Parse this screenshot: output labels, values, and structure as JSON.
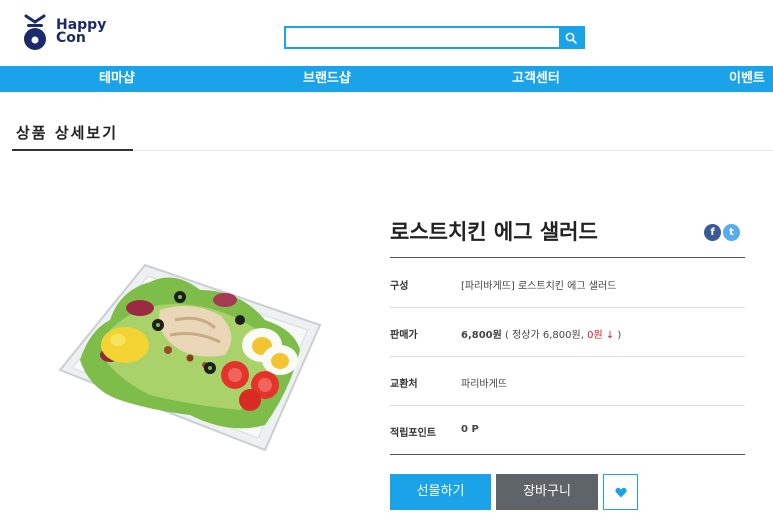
{
  "brand": {
    "line1": "Happy",
    "line2": "Con"
  },
  "search": {
    "value": "",
    "placeholder": ""
  },
  "nav": [
    {
      "label": "테마샵"
    },
    {
      "label": "브랜드샵"
    },
    {
      "label": "고객센터"
    },
    {
      "label": "이벤트"
    }
  ],
  "page_title": "상품 상세보기",
  "product": {
    "name": "로스트치킨 에그 샐러드",
    "rows": [
      {
        "label": "구성",
        "value": "[파리바게뜨] 로스트치킨 에그 샐러드"
      },
      {
        "label": "판매가",
        "price": "6,800원",
        "detail_open": " ( 정상가 6,800원, ",
        "discount": "0원 ↓",
        "detail_close": " )"
      },
      {
        "label": "교환처",
        "value": "파리바게뜨"
      },
      {
        "label": "적립포인트",
        "value": "0 P"
      }
    ]
  },
  "social": {
    "facebook": "f",
    "twitter": "t"
  },
  "buttons": {
    "gift": "선물하기",
    "cart": "장바구니"
  },
  "colors": {
    "accent": "#1aa3e8",
    "cart_button": "#5f6468",
    "brand_navy": "#1b2a6b",
    "discount_red": "#d0202d"
  },
  "icons": [
    "happycon-logo-icon",
    "search-icon",
    "facebook-icon",
    "twitter-icon",
    "heart-icon"
  ]
}
